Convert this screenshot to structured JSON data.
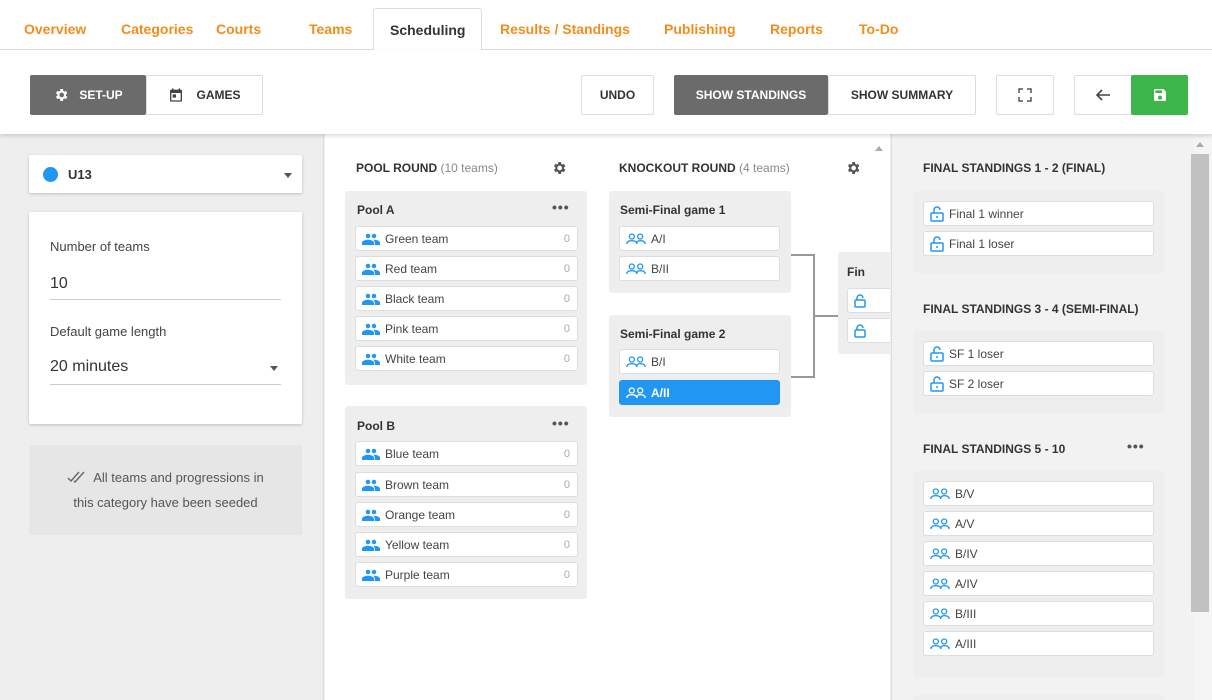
{
  "nav": {
    "tabs": [
      {
        "label": "Overview"
      },
      {
        "label": "Categories"
      },
      {
        "label": "Courts"
      },
      {
        "label": "Teams"
      },
      {
        "label": "Scheduling"
      },
      {
        "label": "Results / Standings"
      },
      {
        "label": "Publishing"
      },
      {
        "label": "Reports"
      },
      {
        "label": "To-Do"
      }
    ],
    "active": "Scheduling"
  },
  "toolbar": {
    "setup_label": "SET-UP",
    "games_label": "GAMES",
    "undo_label": "UNDO",
    "show_standings_label": "SHOW STANDINGS",
    "show_summary_label": "SHOW SUMMARY"
  },
  "left": {
    "category": "U13",
    "category_color": "#2196f3",
    "teams_label": "Number of teams",
    "teams_value": "10",
    "length_label": "Default game length",
    "length_value": "20 minutes",
    "seed_note_line1": "All teams and progressions in",
    "seed_note_line2": "this category have been seeded"
  },
  "pool_round": {
    "title": "POOL ROUND",
    "subtitle": "(10 teams)",
    "pools": [
      {
        "name": "Pool A",
        "teams": [
          {
            "name": "Green team",
            "score": "0"
          },
          {
            "name": "Red team",
            "score": "0"
          },
          {
            "name": "Black team",
            "score": "0"
          },
          {
            "name": "Pink team",
            "score": "0"
          },
          {
            "name": "White team",
            "score": "0"
          }
        ]
      },
      {
        "name": "Pool B",
        "teams": [
          {
            "name": "Blue team",
            "score": "0"
          },
          {
            "name": "Brown team",
            "score": "0"
          },
          {
            "name": "Orange team",
            "score": "0"
          },
          {
            "name": "Yellow team",
            "score": "0"
          },
          {
            "name": "Purple team",
            "score": "0"
          }
        ]
      }
    ]
  },
  "knockout_round": {
    "title": "KNOCKOUT ROUND",
    "subtitle": "(4 teams)",
    "games": [
      {
        "name": "Semi-Final game 1",
        "slots": [
          "A/I",
          "B/II"
        ]
      },
      {
        "name": "Semi-Final game 2",
        "slots": [
          "B/I",
          "A/II"
        ]
      }
    ],
    "final_label": "Fin",
    "selected_slot": "A/II"
  },
  "standings": [
    {
      "title": "FINAL STANDINGS 1 - 2 (FINAL)",
      "items": [
        "Final 1 winner",
        "Final 1 loser"
      ]
    },
    {
      "title": "FINAL STANDINGS 3 - 4 (SEMI-FINAL)",
      "items": [
        "SF 1 loser",
        "SF 2 loser"
      ]
    },
    {
      "title": "FINAL STANDINGS 5 - 10",
      "items": [
        "B/V",
        "A/V",
        "B/IV",
        "A/IV",
        "B/III",
        "A/III"
      ]
    }
  ],
  "colors": {
    "accent_orange": "#f28c1a",
    "primary_blue": "#2196f3",
    "save_green": "#3cb54a",
    "dark_button": "#6b6b6b"
  }
}
